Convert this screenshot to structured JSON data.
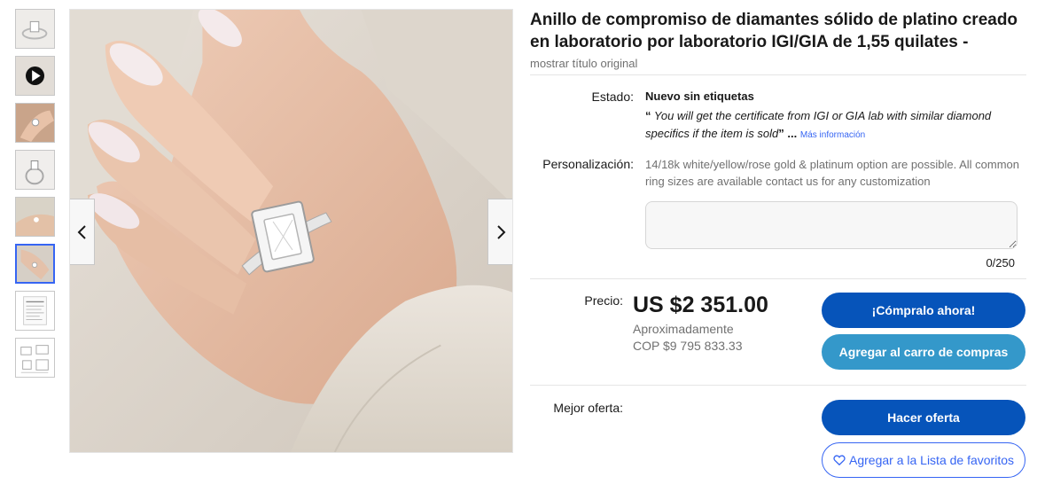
{
  "listing": {
    "title": "Anillo de compromiso de diamantes sólido de platino creado en laboratorio por laboratorio IGI/GIA de 1,55 quilates -",
    "show_original_title": "mostrar título original"
  },
  "gallery": {
    "thumbnail_count": 8,
    "selected_index": 5,
    "thumbnails": [
      {
        "kind": "ring-photo"
      },
      {
        "kind": "video-play-icon"
      },
      {
        "kind": "hand-photo"
      },
      {
        "kind": "ring-photo"
      },
      {
        "kind": "hand-photo"
      },
      {
        "kind": "hand-photo"
      },
      {
        "kind": "certificate-document"
      },
      {
        "kind": "specification-sheet"
      }
    ],
    "prev_icon": "chevron-left-icon",
    "next_icon": "chevron-right-icon"
  },
  "condition": {
    "label": "Estado:",
    "value": "Nuevo sin etiquetas",
    "note": "You will get the certificate from IGI or GIA lab with similar diamond specifics if the item is sold",
    "open_quote": "“",
    "close_quote": "”",
    "ellipsis": "...",
    "more_link": "Más información"
  },
  "personalization": {
    "label": "Personalización:",
    "text": "14/18k white/yellow/rose gold & platinum option are possible. All common ring sizes are available contact us for any customization",
    "input_value": "",
    "char_count": "0/250"
  },
  "pricing": {
    "label": "Precio:",
    "price": "US $2 351.00",
    "approx_label": "Aproximadamente",
    "approx_value": "COP $9 795 833.33"
  },
  "actions": {
    "buy_now": "¡Cómpralo ahora!",
    "add_to_cart": "Agregar al carro de compras",
    "best_offer_label": "Mejor oferta:",
    "make_offer": "Hacer oferta",
    "add_to_watchlist": "Agregar a la Lista de favoritos",
    "watchlist_icon": "heart-icon"
  },
  "colors": {
    "primary_button": "#0654ba",
    "secondary_button": "#3498ca",
    "link": "#3665f3",
    "selected_thumb_border": "#3665f3"
  }
}
